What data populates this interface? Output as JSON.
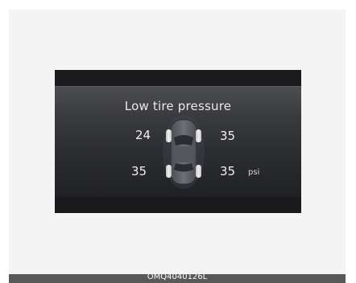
{
  "cluster": {
    "warning_title": "Low tire pressure",
    "tires": {
      "front_left": "24",
      "front_right": "35",
      "rear_left": "35",
      "rear_right": "35"
    },
    "unit": "psi",
    "low_tire": "front_left",
    "colors": {
      "panel": "#3b3c40",
      "frame": "#111214",
      "text": "#f0f0f0",
      "tire_normal": "#d9d9d9",
      "car_body": "#5f6266"
    }
  },
  "caption": "OMQ4040126L"
}
